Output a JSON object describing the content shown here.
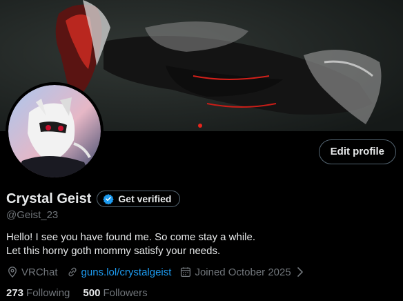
{
  "profile": {
    "display_name": "Crystal Geist",
    "handle": "@Geist_23",
    "bio_lines": [
      "Hello! I see you have found me. So come stay a while.",
      "Let this horny goth mommy satisfy your needs."
    ],
    "location": "VRChat",
    "website": "guns.lol/crystalgeist",
    "joined": "Joined October 2025"
  },
  "actions": {
    "edit_profile": "Edit profile",
    "get_verified": "Get verified"
  },
  "stats": {
    "following_count": "273",
    "following_label": "Following",
    "followers_count": "500",
    "followers_label": "Followers"
  },
  "colors": {
    "accent": "#1d9bf0",
    "muted": "#71767b",
    "text": "#e7e9ea",
    "background": "#000000"
  },
  "icons": {
    "verified": "verified-badge-icon",
    "location": "location-pin-icon",
    "link": "link-icon",
    "calendar": "calendar-icon",
    "chevron": "chevron-right-icon"
  }
}
